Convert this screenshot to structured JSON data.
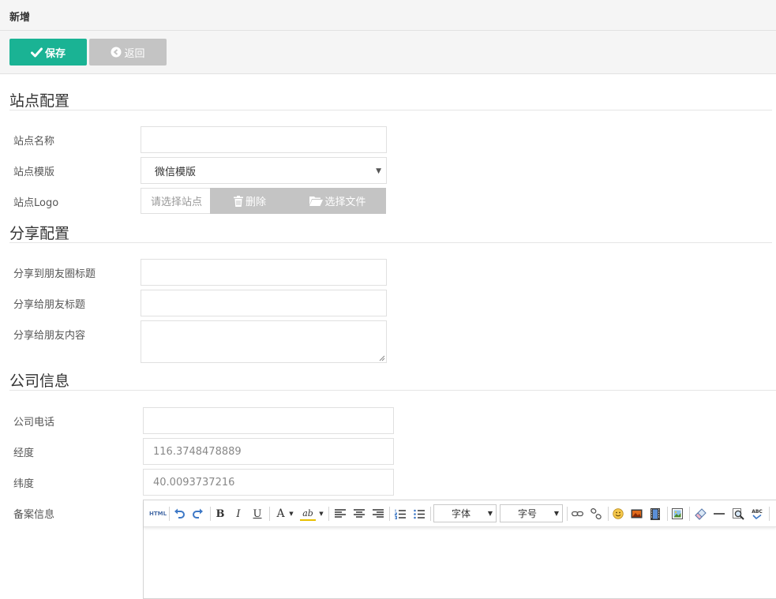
{
  "header": {
    "title": "新增"
  },
  "toolbar": {
    "save_label": "保存",
    "back_label": "返回"
  },
  "site_config": {
    "title": "站点配置",
    "name_label": "站点名称",
    "name_value": "",
    "template_label": "站点模版",
    "template_value": "微信模版",
    "logo_label": "站点Logo",
    "logo_placeholder": "请选择站点",
    "delete_label": "删除",
    "choose_label": "选择文件"
  },
  "share_config": {
    "title": "分享配置",
    "moments_title_label": "分享到朋友圈标题",
    "friend_title_label": "分享给朋友标题",
    "friend_content_label": "分享给朋友内容"
  },
  "company_info": {
    "title": "公司信息",
    "phone_label": "公司电话",
    "phone_value": "",
    "longitude_label": "经度",
    "longitude_value": "116.3748478889",
    "latitude_label": "纬度",
    "latitude_value": "40.0093737216",
    "icp_label": "备案信息"
  },
  "editor": {
    "html_label": "HTML",
    "bold": "B",
    "italic": "I",
    "underline": "U",
    "font_color": "A",
    "highlight": "ab",
    "font_family": "字体",
    "font_size": "字号",
    "spellcheck": "ABC"
  },
  "colors": {
    "primary": "#1ab394",
    "disabled": "#c4c4c4",
    "header_bg": "#f5f5f5"
  }
}
